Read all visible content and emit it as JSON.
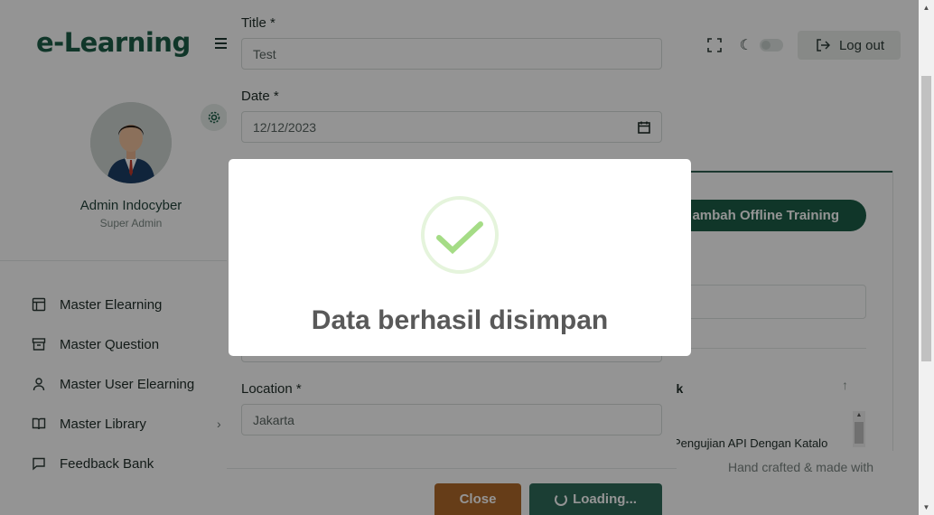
{
  "app": {
    "logo_text": "e-Learning",
    "logout_label": "Log out"
  },
  "user": {
    "name": "Admin Indocyber",
    "role": "Super Admin"
  },
  "sidebar": {
    "items": [
      {
        "label": "Master Elearning",
        "icon": "layout-icon"
      },
      {
        "label": "Master Question",
        "icon": "archive-icon"
      },
      {
        "label": "Master User Elearning",
        "icon": "user-icon"
      },
      {
        "label": "Master Library",
        "icon": "book-icon",
        "has_submenu": true
      },
      {
        "label": "Feedback Bank",
        "icon": "message-icon"
      }
    ]
  },
  "content": {
    "add_button_label": "ambah Offline Training",
    "table_header": "nk",
    "sort_indicator": "↑",
    "first_cell": "Pengujian API Dengan Katalo",
    "footer": "Hand crafted & made with"
  },
  "form": {
    "title_label": "Title *",
    "title_value": "Test",
    "date_label": "Date *",
    "date_value": "12/12/2023",
    "location_label": "Location *",
    "location_value": "Jakarta",
    "close_label": "Close",
    "loading_label": "Loading..."
  },
  "alert": {
    "title": "Data berhasil disimpan",
    "icon": "success-check-icon",
    "accent": "#a5dc86"
  }
}
